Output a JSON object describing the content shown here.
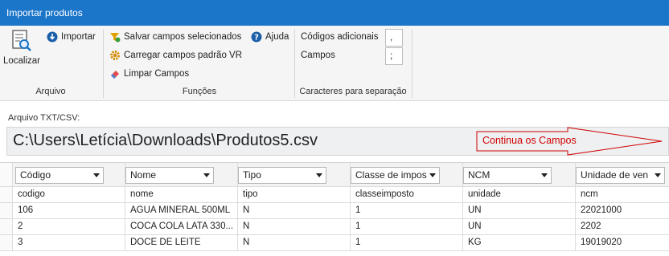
{
  "window": {
    "title": "Importar produtos"
  },
  "ribbon": {
    "arquivo": {
      "label": "Arquivo",
      "localizar": "Localizar",
      "importar": "Importar"
    },
    "funcoes": {
      "label": "Funções",
      "salvar": "Salvar campos selecionados",
      "ajuda": "Ajuda",
      "carregar": "Carregar campos padrão VR",
      "limpar": "Limpar Campos"
    },
    "caracteres": {
      "label": "Caracteres para separação",
      "codigos_label": "Códigos adicionais",
      "codigos_value": ",",
      "campos_label": "Campos",
      "campos_value": ";"
    }
  },
  "file": {
    "label": "Arquivo TXT/CSV:",
    "path": "C:\\Users\\Letícia\\Downloads\\Produtos5.csv",
    "annotation": "Continua os Campos",
    "annotation_color": "#d00000"
  },
  "grid": {
    "columns": [
      {
        "selected": "Código",
        "source": "codigo"
      },
      {
        "selected": "Nome",
        "source": "nome"
      },
      {
        "selected": "Tipo",
        "source": "tipo"
      },
      {
        "selected": "Classe de impos",
        "source": "classeimposto"
      },
      {
        "selected": "NCM",
        "source": "unidade"
      },
      {
        "selected": "Unidade de ven",
        "source": "ncm"
      }
    ],
    "rows": [
      [
        "106",
        "AGUA MINERAL 500ML",
        "N",
        "1",
        "UN",
        "22021000"
      ],
      [
        "2",
        "COCA COLA LATA 330...",
        "N",
        "1",
        "UN",
        "2202"
      ],
      [
        "3",
        "DOCE DE LEITE",
        "N",
        "1",
        "KG",
        "19019020"
      ]
    ]
  },
  "colors": {
    "titlebar": "#1b75c9",
    "accent": "#1b75c9"
  }
}
